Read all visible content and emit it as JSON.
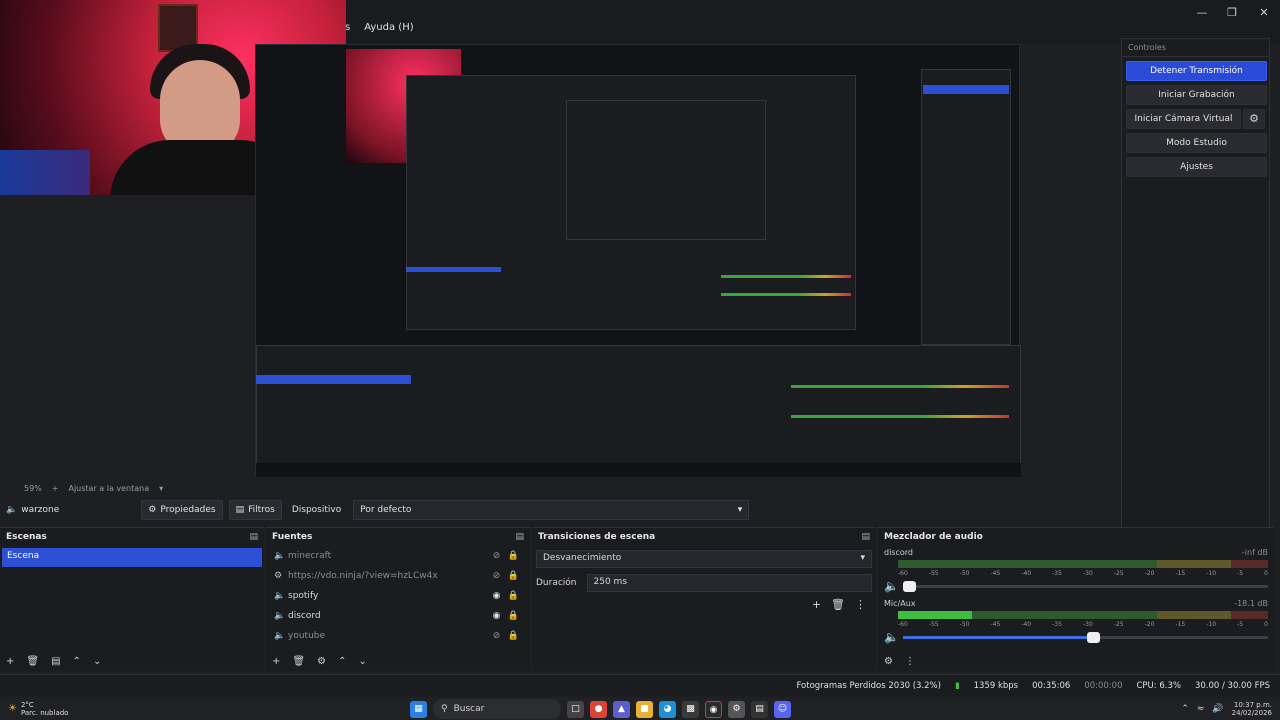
{
  "window": {
    "menu_partial": "s",
    "menu_help": "Ayuda (H)"
  },
  "canvas": {
    "zoom": "59%",
    "fit": "Ajustar a la ventana"
  },
  "controls": {
    "header": "Controles",
    "stop_stream": "Detener Transmisión",
    "start_recording": "Iniciar Grabación",
    "start_virtual_cam": "Iniciar Cámara Virtual",
    "studio_mode": "Modo Estudio",
    "settings": "Ajustes"
  },
  "context": {
    "source": "warzone",
    "properties": "Propiedades",
    "filters": "Filtros",
    "device_label": "Dispositivo",
    "device_value": "Por defecto"
  },
  "scenes": {
    "title": "Escenas",
    "items": [
      "Escena"
    ]
  },
  "sources": {
    "title": "Fuentes",
    "items": [
      {
        "name": "minecraft",
        "visible": false
      },
      {
        "name": "https://vdo.ninja/?view=hzLCw4x",
        "visible": false
      },
      {
        "name": "spotify",
        "visible": true
      },
      {
        "name": "discord",
        "visible": true
      },
      {
        "name": "youtube",
        "visible": false
      }
    ]
  },
  "transitions": {
    "title": "Transiciones de escena",
    "type": "Desvanecimiento",
    "duration_label": "Duración",
    "duration_value": "250 ms"
  },
  "mixer": {
    "title": "Mezclador de audio",
    "ticks": [
      "-60",
      "-55",
      "-50",
      "-45",
      "-40",
      "-35",
      "-30",
      "-25",
      "-20",
      "-15",
      "-10",
      "-5",
      "0"
    ],
    "channels": [
      {
        "name": "discord",
        "db": "-inf dB",
        "meter_level": 0.0,
        "volume": 0.0
      },
      {
        "name": "Mic/Aux",
        "db": "-18.1 dB",
        "meter_level": 0.2,
        "volume": 0.52
      }
    ]
  },
  "status": {
    "dropped": "Fotogramas Perdidos 2030 (3.2%)",
    "bitrate": "1359 kbps",
    "stream_time": "00:35:06",
    "rec_time": "00:00:00",
    "cpu": "CPU: 6.3%",
    "fps": "30.00 / 30.00 FPS"
  },
  "taskbar": {
    "temp": "2°C",
    "weather": "Parc. nublado",
    "search": "Buscar",
    "time": "10:37 p.m.",
    "date": "24/02/2026"
  },
  "colors": {
    "accent": "#2c4ad8",
    "meter_green": "#3fbf3f",
    "bg": "#1e1f22"
  }
}
